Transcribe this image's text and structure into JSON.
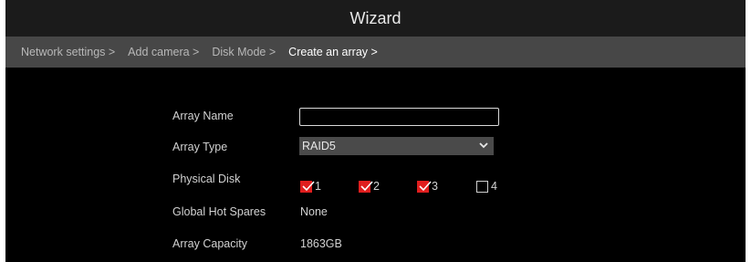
{
  "window": {
    "title": "Wizard"
  },
  "steps": [
    {
      "label": "Network settings >",
      "state": "done"
    },
    {
      "label": "Add camera >",
      "state": "done"
    },
    {
      "label": "Disk Mode >",
      "state": "done"
    },
    {
      "label": "Create an array >",
      "state": "current"
    },
    {
      "label": "",
      "state": "pending"
    },
    {
      "label": "",
      "state": "pending"
    },
    {
      "label": "",
      "state": "pending"
    }
  ],
  "form": {
    "array_name": {
      "label": "Array Name",
      "value": ""
    },
    "array_type": {
      "label": "Array Type",
      "value": "RAID5"
    },
    "physical_disk": {
      "label": "Physical Disk",
      "disks": [
        {
          "number": "1",
          "checked": true
        },
        {
          "number": "2",
          "checked": true
        },
        {
          "number": "3",
          "checked": true
        },
        {
          "number": "4",
          "checked": false
        }
      ]
    },
    "global_hot_spares": {
      "label": "Global Hot Spares",
      "value": "None"
    },
    "array_capacity": {
      "label": "Array Capacity",
      "value": "1863GB"
    }
  },
  "colors": {
    "title_bg": "#1b1b1b",
    "steps_bg": "#474747",
    "content_bg": "#000000",
    "checkbox_checked": "#e01e1e"
  },
  "icons": {
    "select_chevron": "chevron-down-icon",
    "checkmark": "checkmark-icon"
  }
}
